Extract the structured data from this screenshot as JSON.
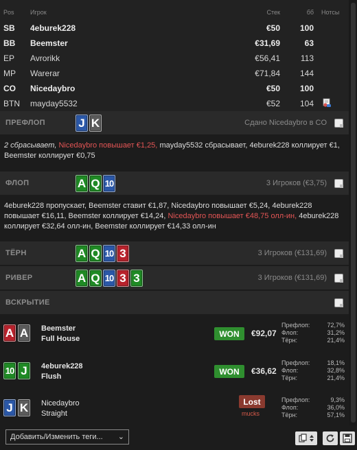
{
  "players_table": {
    "headers": {
      "pos": "Pos",
      "player": "Игрок",
      "stack": "Стек",
      "bb": "бб",
      "notes": "Нотсы"
    },
    "rows": [
      {
        "pos": "SB",
        "name": "4eburek228",
        "stack": "€50",
        "bb": "100",
        "bold": true
      },
      {
        "pos": "BB",
        "name": "Beemster",
        "stack": "€31,69",
        "bb": "63",
        "bold": true
      },
      {
        "pos": "EP",
        "name": "Avrorikk",
        "stack": "€56,41",
        "bb": "113",
        "bold": false
      },
      {
        "pos": "MP",
        "name": "Warerar",
        "stack": "€71,84",
        "bb": "144",
        "bold": false
      },
      {
        "pos": "CO",
        "name": "Nicedaybro",
        "stack": "€50",
        "bb": "100",
        "bold": true
      },
      {
        "pos": "BTN",
        "name": "mayday5532",
        "stack": "€52",
        "bb": "104",
        "bold": false,
        "note_icon": "note-icon"
      }
    ]
  },
  "preflop": {
    "title": "ПРЕФЛОП",
    "cards": [
      "J",
      "K"
    ],
    "info": "Сдано Nicedaybro в CO",
    "actions": {
      "fold_text": "2 сбрасывает,",
      "raise_text": "Nicedaybro повышает €1,25,",
      "rest_text": "mayday5532 сбрасывает, 4eburek228 коллирует €1, Beemster коллирует €0,75"
    }
  },
  "flop": {
    "title": "ФЛОП",
    "cards": [
      "A",
      "Q",
      "10"
    ],
    "info": "3 Игроков (€3,75)",
    "actions": {
      "text_1": "4eburek228 пропускает, Beemster ставит €1,87, Nicedaybro повышает €5,24, 4eburek228 повышает €16,11, Beemster коллирует €14,24,",
      "raise_text": "Nicedaybro повышает €48,75 олл-ин,",
      "text_2": "4eburek228 коллирует €32,64 олл-ин, Beemster коллирует €14,33 олл-ин"
    }
  },
  "turn": {
    "title": "ТЁРН",
    "cards": [
      "A",
      "Q",
      "10",
      "3"
    ],
    "info": "3 Игроков (€131,69)"
  },
  "river": {
    "title": "РИВЕР",
    "cards": [
      "A",
      "Q",
      "10",
      "3",
      "3"
    ],
    "info": "3 Игроков (€131,69)"
  },
  "showdown": {
    "title": "ВСКРЫТИЕ",
    "players": [
      {
        "cards": [
          "A",
          "A"
        ],
        "name": "Beemster",
        "hand": "Full House",
        "badge": "WON",
        "amount": "€92,07",
        "equity": [
          {
            "label": "Префлоп:",
            "value": "72,7%"
          },
          {
            "label": "Флоп:",
            "value": "31,2%"
          },
          {
            "label": "Тёрн:",
            "value": "21,4%"
          }
        ]
      },
      {
        "cards": [
          "10",
          "J"
        ],
        "name": "4eburek228",
        "hand": "Flush",
        "badge": "WON",
        "amount": "€36,62",
        "equity": [
          {
            "label": "Префлоп:",
            "value": "18,1%"
          },
          {
            "label": "Флоп:",
            "value": "32,8%"
          },
          {
            "label": "Тёрн:",
            "value": "21,4%"
          }
        ]
      },
      {
        "cards": [
          "J",
          "K"
        ],
        "name": "Nicedaybro",
        "hand": "Straight",
        "badge": "Lost",
        "sub": "mucks",
        "equity": [
          {
            "label": "Префлоп:",
            "value": "9,3%"
          },
          {
            "label": "Флоп:",
            "value": "36,0%"
          },
          {
            "label": "Тёрн:",
            "value": "57,1%"
          }
        ]
      }
    ]
  },
  "footer": {
    "tags_label": "Добавить/Изменить теги...",
    "buttons": [
      "copy-icon",
      "refresh-icon",
      "save-icon"
    ]
  },
  "colors": {
    "spade": "#2b58a8",
    "club": "#1f8a24",
    "heart": "#b8222c",
    "grey": "#5b5b5b",
    "won": "#2f8f2f",
    "lost": "#8a3a2f",
    "raise": "#e45555"
  }
}
